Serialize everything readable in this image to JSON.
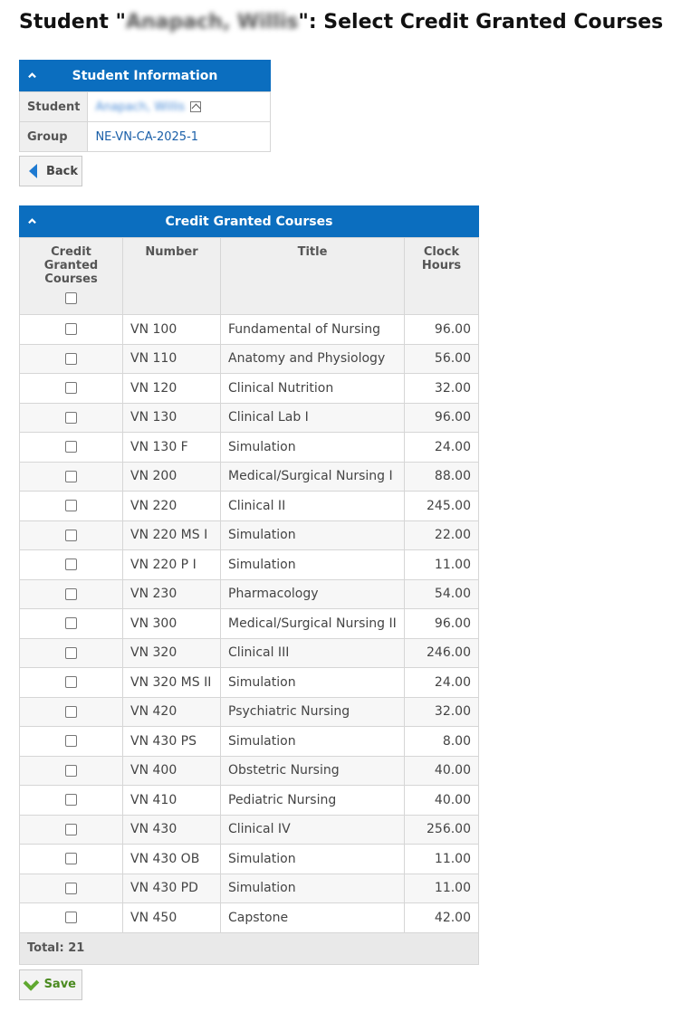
{
  "page": {
    "title_prefix": "Student \"",
    "title_redacted": "Anapach, Willis",
    "title_suffix": "\": Select Credit Granted Courses"
  },
  "student_info": {
    "header": "Student Information",
    "rows": [
      {
        "label": "Student",
        "value": "Anapach, Willis"
      },
      {
        "label": "Group",
        "value": "NE-VN-CA-2025-1"
      }
    ]
  },
  "back_button": "Back",
  "courses": {
    "header": "Credit Granted Courses",
    "columns": {
      "credit": "Credit Granted Courses",
      "number": "Number",
      "title": "Title",
      "hours": "Clock Hours"
    },
    "rows": [
      {
        "number": "VN 100",
        "title": "Fundamental of Nursing",
        "hours": "96.00"
      },
      {
        "number": "VN 110",
        "title": "Anatomy and Physiology",
        "hours": "56.00"
      },
      {
        "number": "VN 120",
        "title": "Clinical Nutrition",
        "hours": "32.00"
      },
      {
        "number": "VN 130",
        "title": "Clinical Lab I",
        "hours": "96.00"
      },
      {
        "number": "VN 130 F",
        "title": "Simulation",
        "hours": "24.00"
      },
      {
        "number": "VN 200",
        "title": "Medical/Surgical Nursing I",
        "hours": "88.00"
      },
      {
        "number": "VN 220",
        "title": "Clinical II",
        "hours": "245.00"
      },
      {
        "number": "VN 220 MS I",
        "title": "Simulation",
        "hours": "22.00"
      },
      {
        "number": "VN 220 P I",
        "title": "Simulation",
        "hours": "11.00"
      },
      {
        "number": "VN 230",
        "title": "Pharmacology",
        "hours": "54.00"
      },
      {
        "number": "VN 300",
        "title": "Medical/Surgical Nursing II",
        "hours": "96.00"
      },
      {
        "number": "VN 320",
        "title": "Clinical III",
        "hours": "246.00"
      },
      {
        "number": "VN 320 MS II",
        "title": "Simulation",
        "hours": "24.00"
      },
      {
        "number": "VN 420",
        "title": "Psychiatric Nursing",
        "hours": "32.00"
      },
      {
        "number": "VN 430 PS",
        "title": "Simulation",
        "hours": "8.00"
      },
      {
        "number": "VN 400",
        "title": "Obstetric Nursing",
        "hours": "40.00"
      },
      {
        "number": "VN 410",
        "title": "Pediatric Nursing",
        "hours": "40.00"
      },
      {
        "number": "VN 430",
        "title": "Clinical IV",
        "hours": "256.00"
      },
      {
        "number": "VN 430 OB",
        "title": "Simulation",
        "hours": "11.00"
      },
      {
        "number": "VN 430 PD",
        "title": "Simulation",
        "hours": "11.00"
      },
      {
        "number": "VN 450",
        "title": "Capstone",
        "hours": "42.00"
      }
    ],
    "total_label": "Total: 21"
  },
  "save_button": "Save",
  "colors": {
    "panel_header": "#0b6ebf",
    "link": "#1a5fa8",
    "save_check": "#5fa82f"
  },
  "icons": [
    "chevron-up-icon",
    "home-icon",
    "back-arrow-icon",
    "checkmark-icon"
  ]
}
